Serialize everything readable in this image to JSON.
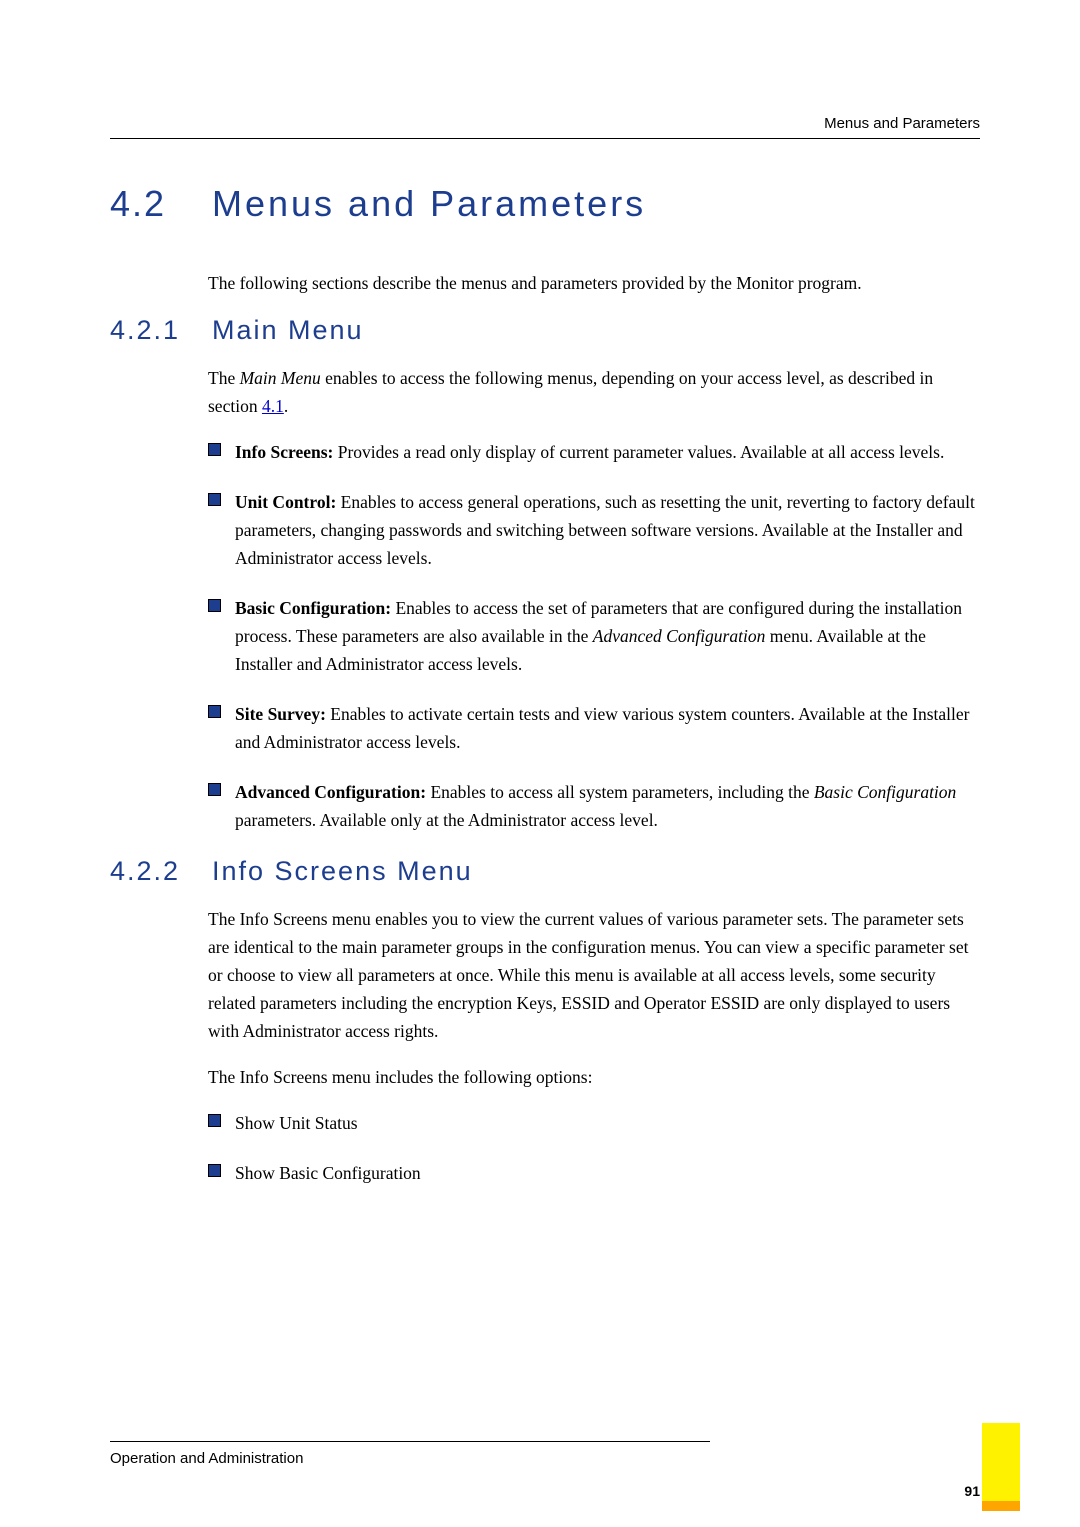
{
  "header": {
    "running_head": "Menus and Parameters"
  },
  "h1": {
    "number": "4.2",
    "title": "Menus and Parameters"
  },
  "intro": "The following sections describe the menus and parameters provided by the Monitor program.",
  "s421": {
    "number": "4.2.1",
    "title": "Main Menu",
    "p1_a": "The ",
    "p1_b": "Main Menu",
    "p1_c": " enables to access the following menus, depending on your access level, as described in section ",
    "p1_link": "4.1",
    "p1_d": ".",
    "bullets": {
      "b1_label": "Info Screens:",
      "b1_text": " Provides a read only display of current parameter values. Available at all access levels.",
      "b2_label": "Unit Control:",
      "b2_text": " Enables to access general operations, such as resetting the unit, reverting to factory default parameters, changing passwords and switching between software versions. Available at the Installer and Administrator access levels.",
      "b3_label": "Basic Configuration:",
      "b3_text_a": " Enables to access the set of parameters that are configured during the installation process. These parameters are also available in the ",
      "b3_text_i": "Advanced Configuration",
      "b3_text_b": " menu. Available at the Installer and Administrator access levels.",
      "b4_label": "Site Survey:",
      "b4_text": " Enables to activate certain tests and view various system counters. Available at the Installer and Administrator access levels.",
      "b5_label": "Advanced Configuration:",
      "b5_text_a": " Enables to access all system parameters, including the ",
      "b5_text_i": "Basic Configuration",
      "b5_text_b": " parameters. Available only at the Administrator access level."
    }
  },
  "s422": {
    "number": "4.2.2",
    "title": "Info Screens Menu",
    "p1": "The Info Screens menu enables you to view the current values of various parameter sets. The parameter sets are identical to the main parameter groups in the configuration menus. You can view a specific parameter set or choose to view all parameters at once. While this menu is available at all access levels, some security related parameters including the encryption Keys, ESSID and Operator ESSID are only displayed to users with Administrator access rights.",
    "p2": "The Info Screens menu includes the following options:",
    "bullets": {
      "b1": "Show Unit Status",
      "b2": "Show Basic Configuration"
    }
  },
  "footer": {
    "left": "Operation and Administration",
    "page": "91"
  }
}
